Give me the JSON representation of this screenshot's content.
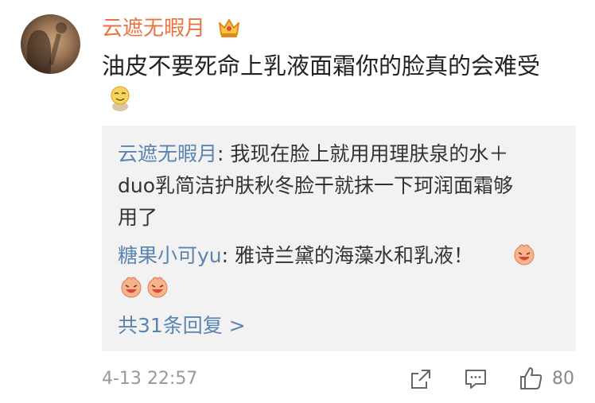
{
  "comment": {
    "username": "云遮无暇月",
    "text": "油皮不要死命上乳液面霜你的脸真的会难受",
    "timestamp": "4-13 22:57",
    "like_count": "80",
    "icons": [
      "crown-icon",
      "emoji-icon",
      "share-icon",
      "comment-icon",
      "like-icon"
    ]
  },
  "replies": {
    "items": [
      {
        "name": "云遮无暇月",
        "sep": ": ",
        "line1": "我现在脸上就用用理肤泉的水＋",
        "line2": "duo乳简洁护肤秋冬脸干就抹一下珂润面霜够",
        "line3": "用了"
      },
      {
        "name": "糖果小可yu",
        "sep": ": ",
        "text": "雅诗兰黛的海藻水和乳液！"
      }
    ],
    "more_label": "共31条回复 >"
  }
}
